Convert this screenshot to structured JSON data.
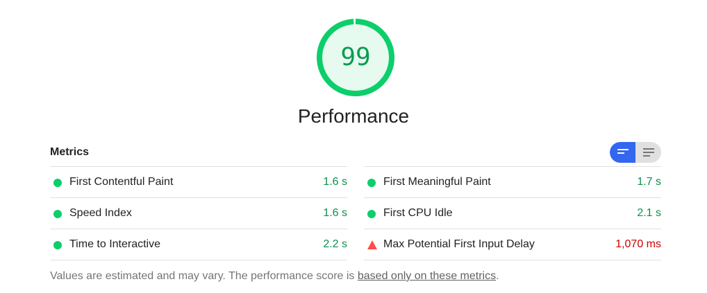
{
  "gauge": {
    "score": "99",
    "score_fraction": 0.99,
    "title": "Performance",
    "color": "#0cce6b",
    "fill_color": "#e6faef"
  },
  "metrics": {
    "title": "Metrics",
    "toggle": {
      "active_icon": "lines-short-icon",
      "inactive_icon": "lines-long-icon",
      "active_color": "#3367f0"
    },
    "left": [
      {
        "label": "First Contentful Paint",
        "value": "1.6 s",
        "status": "pass"
      },
      {
        "label": "Speed Index",
        "value": "1.6 s",
        "status": "pass"
      },
      {
        "label": "Time to Interactive",
        "value": "2.2 s",
        "status": "pass"
      }
    ],
    "right": [
      {
        "label": "First Meaningful Paint",
        "value": "1.7 s",
        "status": "pass"
      },
      {
        "label": "First CPU Idle",
        "value": "2.1 s",
        "status": "pass"
      },
      {
        "label": "Max Potential First Input Delay",
        "value": "1,070 ms",
        "status": "fail"
      }
    ]
  },
  "footnote": {
    "text": "Values are estimated and may vary. The performance score is ",
    "link": "based only on these metrics",
    "suffix": "."
  },
  "colors": {
    "pass": "#0cce6b",
    "fail": "#ff4e42"
  }
}
